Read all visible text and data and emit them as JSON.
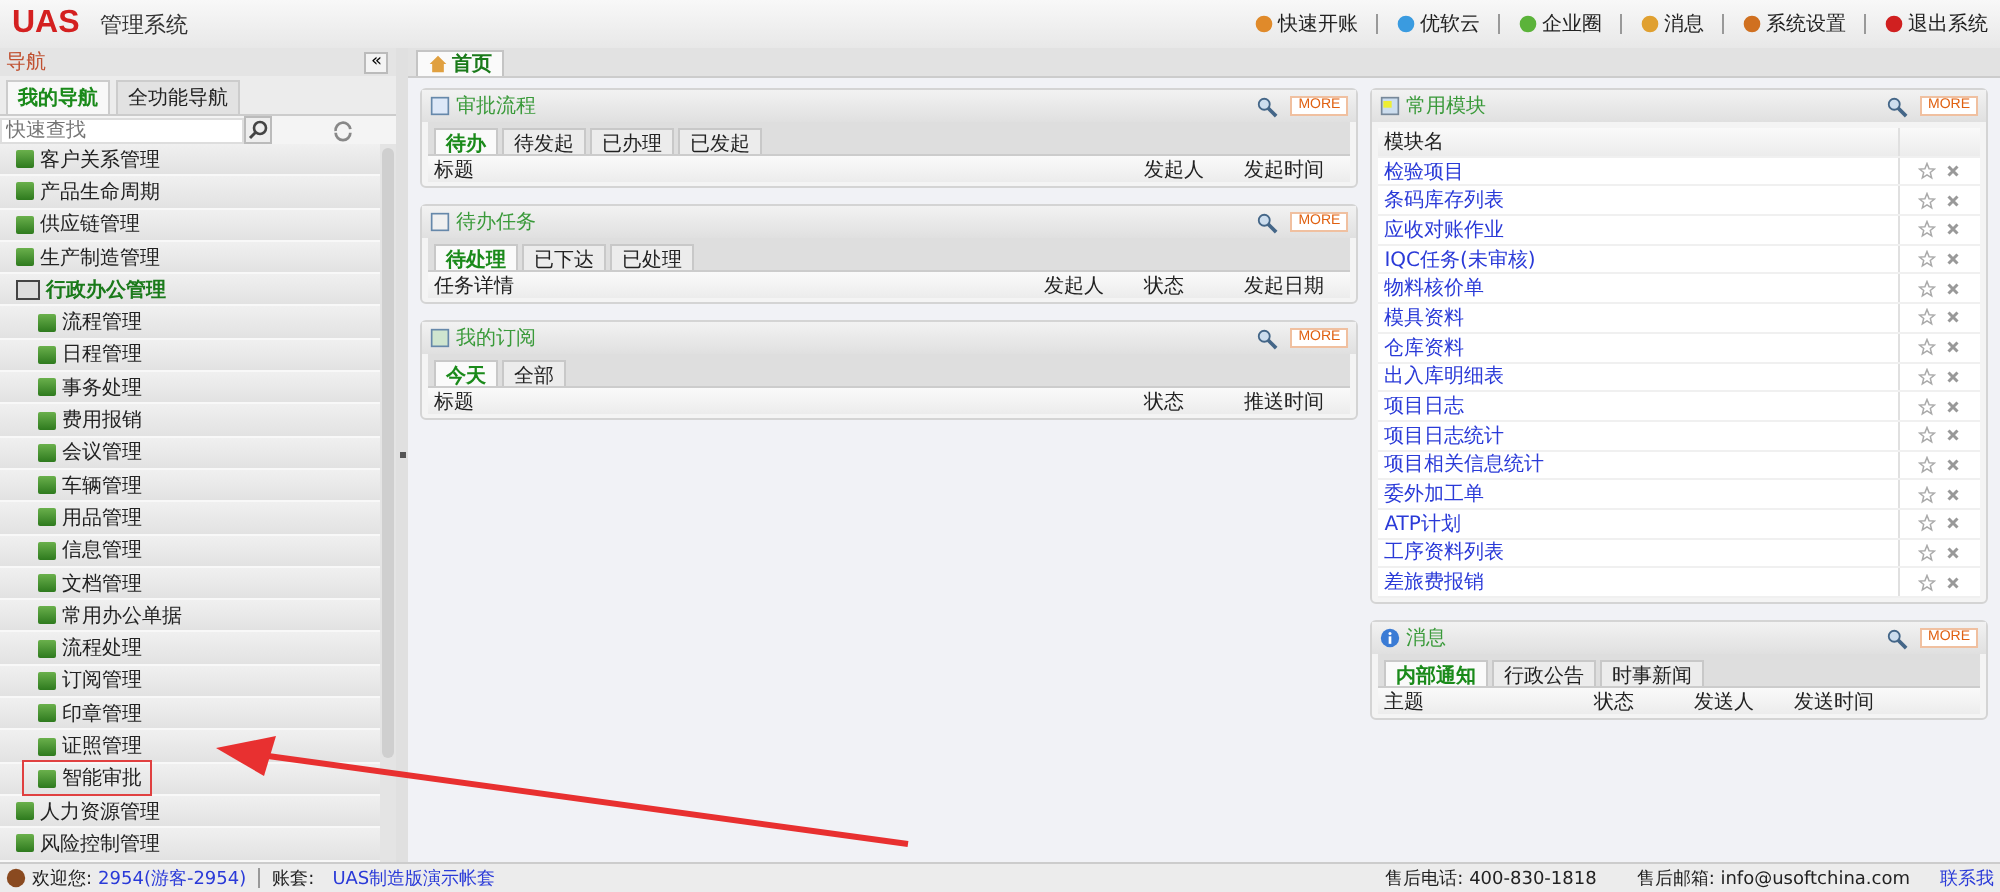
{
  "header": {
    "logo": "UAS",
    "title": "管理系统",
    "links": [
      {
        "label": "快速开账",
        "kind": "account"
      },
      {
        "label": "优软云",
        "kind": "cloud"
      },
      {
        "label": "企业圈",
        "kind": "circle"
      },
      {
        "label": "消息",
        "kind": "chat"
      },
      {
        "label": "系统设置",
        "kind": "tools"
      },
      {
        "label": "退出系统",
        "kind": "power"
      }
    ]
  },
  "nav": {
    "title": "导航",
    "collapse": "«",
    "tabs": [
      {
        "label": "我的导航",
        "selected": true
      },
      {
        "label": "全功能导航",
        "selected": false
      }
    ],
    "search": {
      "placeholder": "快速查找"
    },
    "items": [
      {
        "label": "客户关系管理",
        "expanded": false
      },
      {
        "label": "产品生命周期",
        "expanded": false
      },
      {
        "label": "供应链管理",
        "expanded": false
      },
      {
        "label": "生产制造管理",
        "expanded": false
      },
      {
        "label": "行政办公管理",
        "expanded": true,
        "children": [
          {
            "label": "流程管理",
            "highlighted": false
          },
          {
            "label": "日程管理",
            "highlighted": false
          },
          {
            "label": "事务处理",
            "highlighted": false
          },
          {
            "label": "费用报销",
            "highlighted": false
          },
          {
            "label": "会议管理",
            "highlighted": false
          },
          {
            "label": "车辆管理",
            "highlighted": false
          },
          {
            "label": "用品管理",
            "highlighted": false
          },
          {
            "label": "信息管理",
            "highlighted": false
          },
          {
            "label": "文档管理",
            "highlighted": false
          },
          {
            "label": "常用办公单据",
            "highlighted": false
          },
          {
            "label": "流程处理",
            "highlighted": false
          },
          {
            "label": "订阅管理",
            "highlighted": false
          },
          {
            "label": "印章管理",
            "highlighted": false
          },
          {
            "label": "证照管理",
            "highlighted": false
          },
          {
            "label": "智能审批",
            "highlighted": true
          }
        ]
      },
      {
        "label": "人力资源管理",
        "expanded": false
      },
      {
        "label": "风险控制管理",
        "expanded": false
      }
    ]
  },
  "main_tabs": [
    {
      "label": "首页",
      "selected": true
    }
  ],
  "left_panels": [
    {
      "title": "审批流程",
      "more": "MORE",
      "tabs": [
        {
          "label": "待办",
          "selected": true
        },
        {
          "label": "待发起",
          "selected": false
        },
        {
          "label": "已办理",
          "selected": false
        },
        {
          "label": "已发起",
          "selected": false
        }
      ],
      "columns": [
        "标题",
        "发起人",
        "发起时间"
      ]
    },
    {
      "title": "待办任务",
      "more": "MORE",
      "tabs": [
        {
          "label": "待处理",
          "selected": true
        },
        {
          "label": "已下达",
          "selected": false
        },
        {
          "label": "已处理",
          "selected": false
        }
      ],
      "columns": [
        "任务详情",
        "发起人",
        "状态",
        "发起日期"
      ]
    },
    {
      "title": "我的订阅",
      "more": "MORE",
      "tabs": [
        {
          "label": "今天",
          "selected": true
        },
        {
          "label": "全部",
          "selected": false
        }
      ],
      "columns": [
        "标题",
        "状态",
        "推送时间"
      ]
    }
  ],
  "modules": {
    "title": "常用模块",
    "more": "MORE",
    "column": "模块名",
    "rows": [
      "检验项目",
      "条码库存列表",
      "应收对账作业",
      "IQC任务(未审核)",
      "物料核价单",
      "模具资料",
      "仓库资料",
      "出入库明细表",
      "项目日志",
      "项目日志统计",
      "项目相关信息统计",
      "委外加工单",
      "ATP计划",
      "工序资料列表",
      "差旅费报销"
    ]
  },
  "messages": {
    "title": "消息",
    "more": "MORE",
    "tabs": [
      {
        "label": "内部通知",
        "selected": true
      },
      {
        "label": "行政公告",
        "selected": false
      },
      {
        "label": "时事新闻",
        "selected": false
      }
    ],
    "columns": [
      "主题",
      "状态",
      "发送人",
      "发送时间"
    ]
  },
  "status_bar": {
    "welcome": "欢迎您:",
    "user": "2954(游客-2954)",
    "account_label": "账套:",
    "account": "UAS制造版演示帐套",
    "phone": "售后电话: 400-830-1818",
    "email": "售后邮箱: info@usoftchina.com",
    "contact": "联系我"
  }
}
